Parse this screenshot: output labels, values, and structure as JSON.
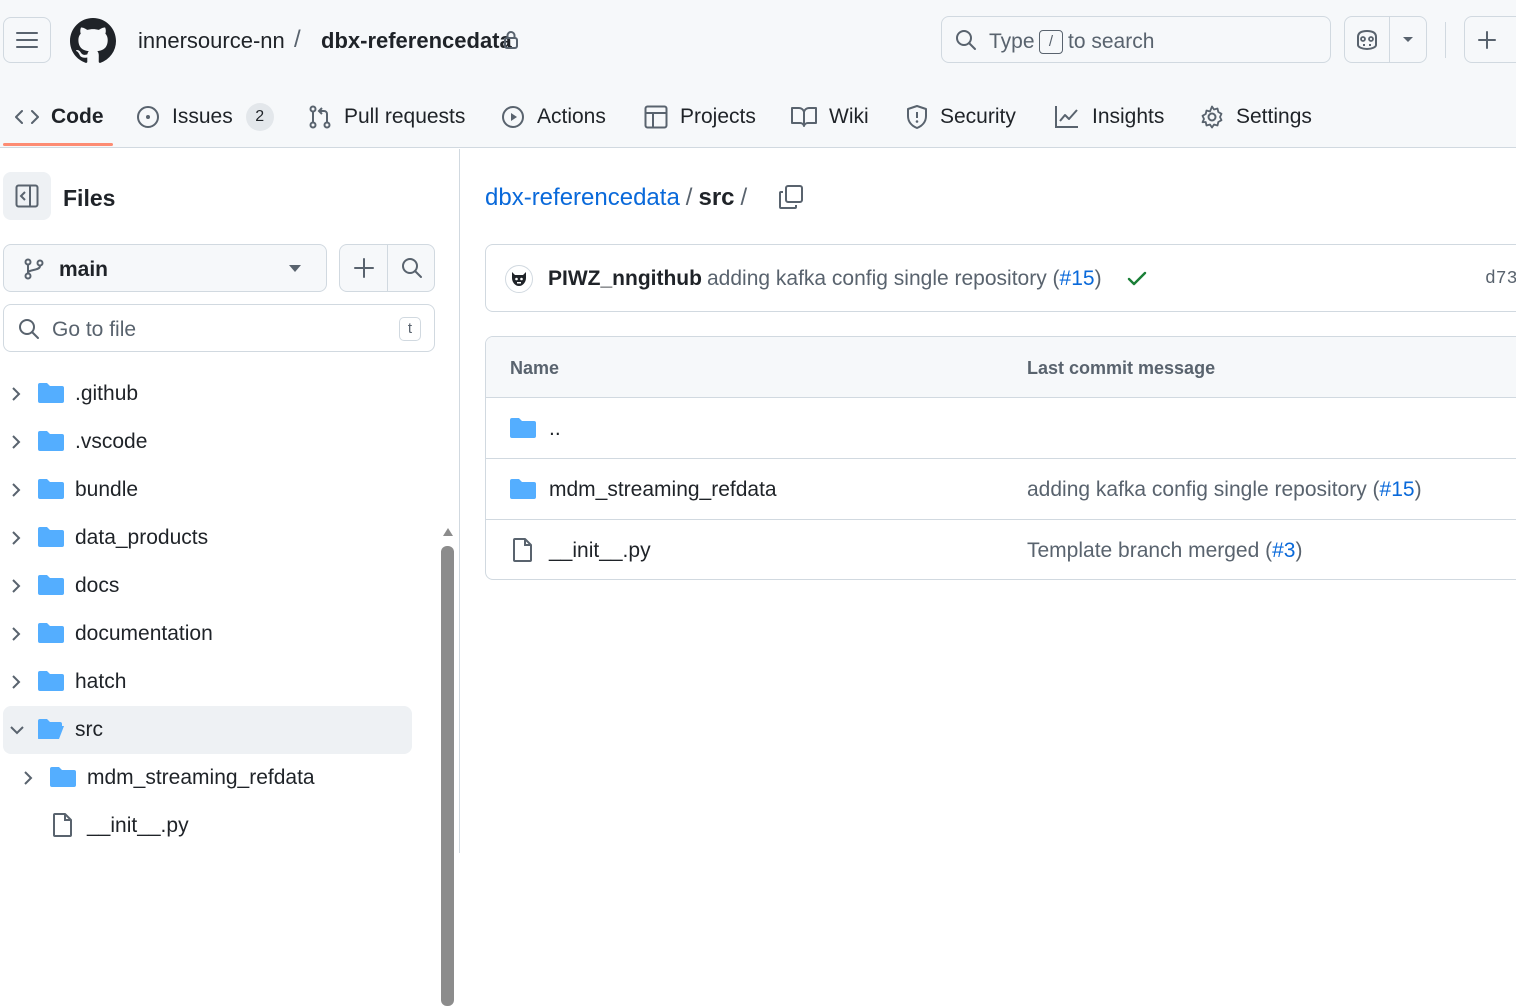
{
  "header": {
    "owner": "innersource-nn",
    "separator": "/",
    "repo": "dbx-referencedata",
    "search": {
      "prefix": "Type",
      "key": "/",
      "suffix": "to search"
    }
  },
  "tabs": [
    {
      "label": "Code",
      "icon": "code-icon",
      "active": true
    },
    {
      "label": "Issues",
      "icon": "issue-icon",
      "count": "2"
    },
    {
      "label": "Pull requests",
      "icon": "pull-request-icon"
    },
    {
      "label": "Actions",
      "icon": "play-icon"
    },
    {
      "label": "Projects",
      "icon": "table-icon"
    },
    {
      "label": "Wiki",
      "icon": "book-icon"
    },
    {
      "label": "Security",
      "icon": "shield-icon"
    },
    {
      "label": "Insights",
      "icon": "graph-icon"
    },
    {
      "label": "Settings",
      "icon": "gear-icon"
    }
  ],
  "sidebar": {
    "title": "Files",
    "branch": "main",
    "goto_placeholder": "Go to file",
    "goto_key": "t",
    "tree": [
      {
        "label": ".github",
        "type": "folder"
      },
      {
        "label": ".vscode",
        "type": "folder"
      },
      {
        "label": "bundle",
        "type": "folder"
      },
      {
        "label": "data_products",
        "type": "folder"
      },
      {
        "label": "docs",
        "type": "folder"
      },
      {
        "label": "documentation",
        "type": "folder"
      },
      {
        "label": "hatch",
        "type": "folder"
      },
      {
        "label": "src",
        "type": "folder-open",
        "selected": true
      },
      {
        "label": "mdm_streaming_refdata",
        "type": "folder",
        "depth": 1
      },
      {
        "label": "__init__.py",
        "type": "file",
        "depth": 1
      }
    ]
  },
  "main": {
    "breadcrumb": {
      "repo": "dbx-referencedata",
      "sep": "/",
      "current": "src",
      "trail": "/"
    },
    "commit": {
      "author": "PIWZ_nngithub",
      "message": "adding kafka config single repository (",
      "pr": "#15",
      "message_end": ")",
      "hash": "d73"
    },
    "table": {
      "headers": {
        "name": "Name",
        "last_commit": "Last commit message"
      },
      "rows": [
        {
          "name": "..",
          "type": "folder",
          "msg": "",
          "pr": "",
          "end": ""
        },
        {
          "name": "mdm_streaming_refdata",
          "type": "folder",
          "msg": "adding kafka config single repository (",
          "pr": "#15",
          "end": ")"
        },
        {
          "name": "__init__.py",
          "type": "file",
          "msg": "Template branch merged (",
          "pr": "#3",
          "end": ")"
        }
      ]
    }
  },
  "colors": {
    "accent": "#0969da",
    "tab_underline": "#fd8c73",
    "folder": "#54aeff",
    "success": "#1a7f37"
  }
}
